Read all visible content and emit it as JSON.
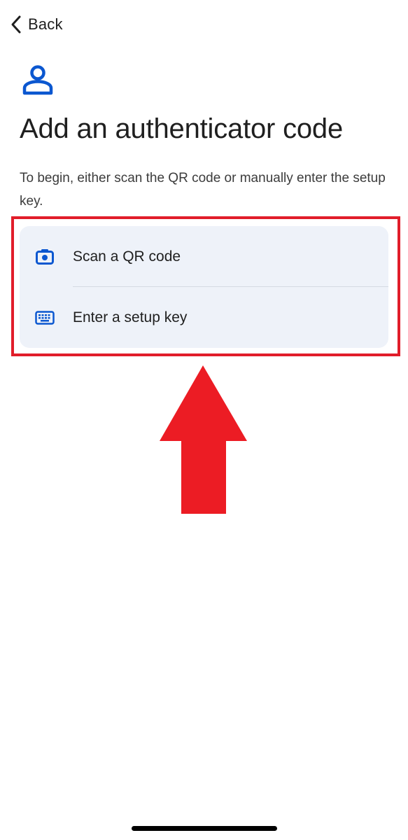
{
  "nav": {
    "back_label": "Back"
  },
  "header": {
    "title": "Add an authenticator code",
    "subtitle": "To begin, either scan the QR code or manually enter the setup key."
  },
  "options": [
    {
      "label": "Scan a QR code",
      "icon": "camera-icon"
    },
    {
      "label": "Enter a setup key",
      "icon": "keyboard-icon"
    }
  ],
  "colors": {
    "accent": "#0b57d0",
    "highlight": "#e11d2a",
    "card_background": "#eef2f9",
    "text": "#1f1f1f"
  }
}
